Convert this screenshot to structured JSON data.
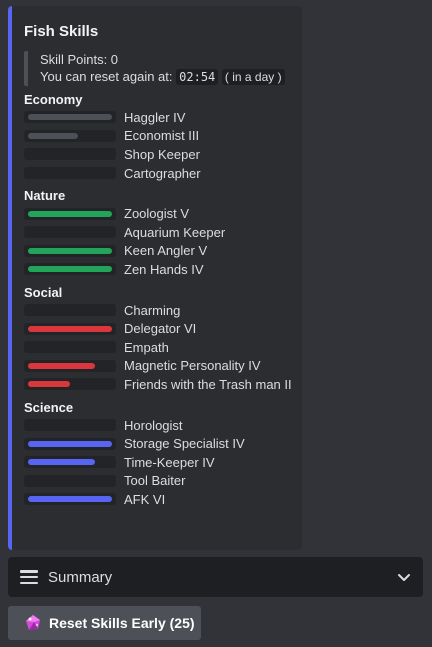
{
  "embed": {
    "title": "Fish Skills",
    "accent": "#5865f2",
    "skill_points": "Skill Points: 0",
    "reset_prefix": "You can reset again at:",
    "reset_time": "02:54",
    "reset_relative": "( in a day )"
  },
  "sections": [
    {
      "title": "Economy",
      "color": "#4e5058",
      "skills": [
        {
          "label": "Haggler IV",
          "fill": 1.0
        },
        {
          "label": "Economist III",
          "fill": 0.6
        },
        {
          "label": "Shop Keeper",
          "fill": 0
        },
        {
          "label": "Cartographer",
          "fill": 0
        }
      ]
    },
    {
      "title": "Nature",
      "color": "#23a559",
      "skills": [
        {
          "label": "Zoologist V",
          "fill": 1.0
        },
        {
          "label": "Aquarium Keeper",
          "fill": 0
        },
        {
          "label": "Keen Angler V",
          "fill": 1.0
        },
        {
          "label": "Zen Hands IV",
          "fill": 1.0
        }
      ]
    },
    {
      "title": "Social",
      "color": "#da373c",
      "skills": [
        {
          "label": "Charming",
          "fill": 0
        },
        {
          "label": "Delegator VI",
          "fill": 1.0
        },
        {
          "label": "Empath",
          "fill": 0
        },
        {
          "label": "Magnetic Personality IV",
          "fill": 0.8
        },
        {
          "label": "Friends with the Trash man II",
          "fill": 0.5
        }
      ]
    },
    {
      "title": "Science",
      "color": "#5865f2",
      "skills": [
        {
          "label": "Horologist",
          "fill": 0
        },
        {
          "label": "Storage Specialist IV",
          "fill": 1.0
        },
        {
          "label": "Time-Keeper IV",
          "fill": 0.8
        },
        {
          "label": "Tool Baiter",
          "fill": 0
        },
        {
          "label": "AFK VI",
          "fill": 1.0
        }
      ]
    }
  ],
  "summary": {
    "label": "Summary",
    "icon": "hamburger-icon",
    "chevron": "chevron-down-icon"
  },
  "reset_button": {
    "label": "Reset Skills Early (25)",
    "icon": "gem-icon"
  }
}
